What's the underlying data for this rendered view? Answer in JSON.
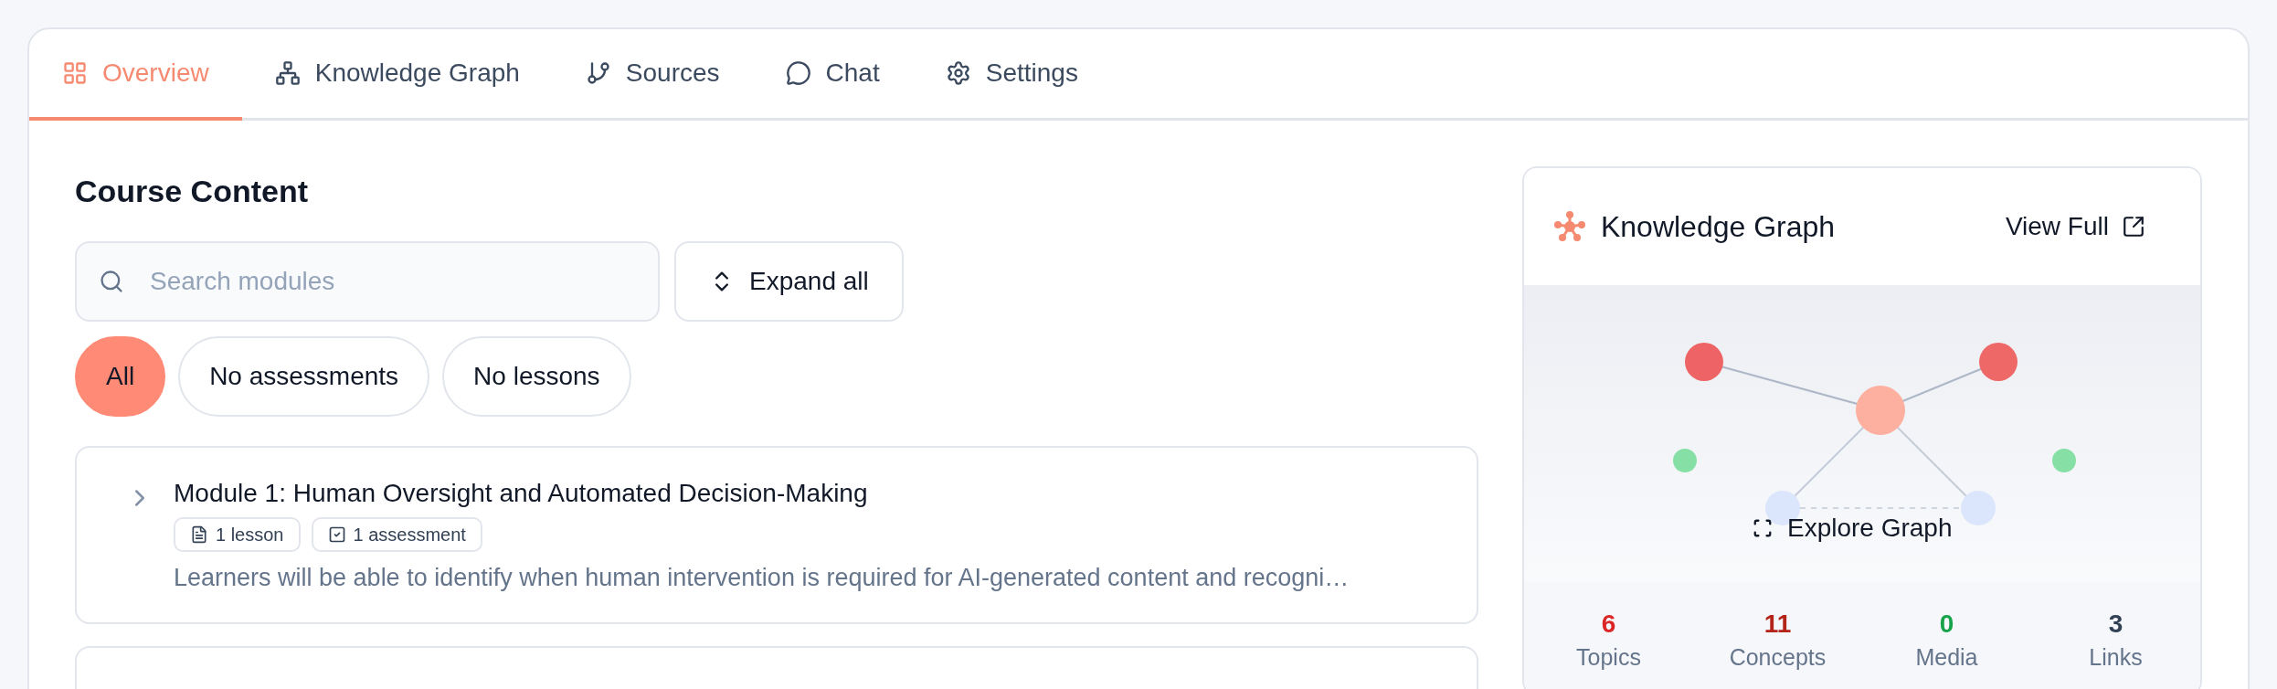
{
  "tabs": [
    {
      "label": "Overview",
      "selected": true
    },
    {
      "label": "Knowledge Graph",
      "selected": false
    },
    {
      "label": "Sources",
      "selected": false
    },
    {
      "label": "Chat",
      "selected": false
    },
    {
      "label": "Settings",
      "selected": false
    }
  ],
  "course_content": {
    "title": "Course Content",
    "search": {
      "placeholder": "Search modules"
    },
    "expand_button": "Expand all",
    "filters": [
      {
        "label": "All",
        "selected": true
      },
      {
        "label": "No assessments",
        "selected": false
      },
      {
        "label": "No lessons",
        "selected": false
      }
    ],
    "modules": [
      {
        "title": "Module 1: Human Oversight and Automated Decision-Making",
        "expanded": false,
        "badges": [
          {
            "kind": "lesson",
            "label": "1 lesson"
          },
          {
            "kind": "assessment",
            "label": "1 assessment"
          }
        ],
        "description": "Learners will be able to identify when human intervention is required for AI-generated content and recogni…"
      }
    ]
  },
  "knowledge_graph": {
    "title": "Knowledge Graph",
    "view_full": "View Full",
    "explore_button": "Explore Graph",
    "stats": [
      {
        "value": "6",
        "label": "Topics",
        "color": "#dc2626"
      },
      {
        "value": "11",
        "label": "Concepts",
        "color": "#b42318"
      },
      {
        "value": "0",
        "label": "Media",
        "color": "#16a34a"
      },
      {
        "value": "3",
        "label": "Links",
        "color": "#334155"
      }
    ]
  }
}
